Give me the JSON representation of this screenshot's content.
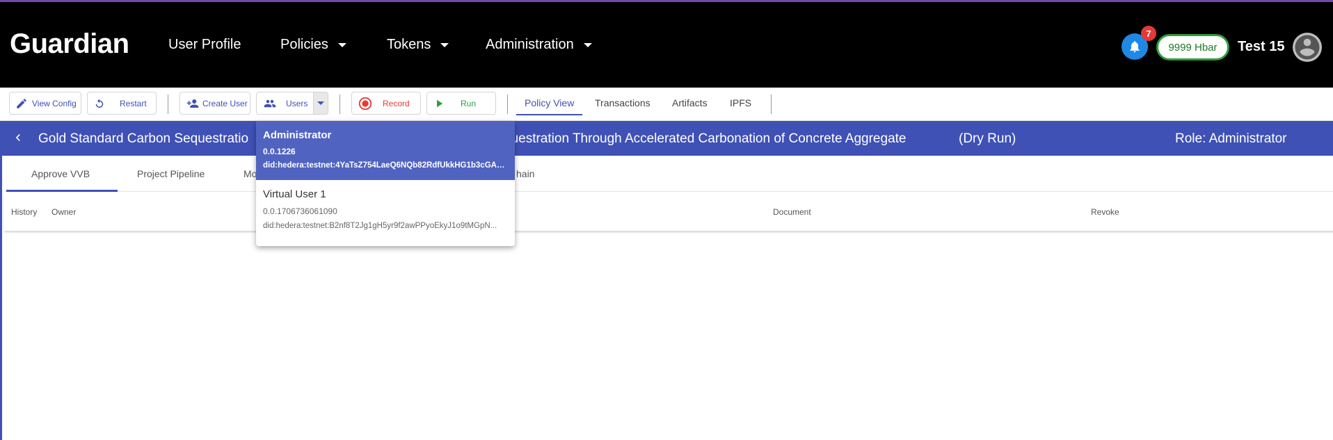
{
  "header": {
    "brand": "Guardian",
    "nav": [
      "User Profile",
      "Policies",
      "Tokens",
      "Administration"
    ],
    "notification_count": "7",
    "balance": "9999 Hbar",
    "username": "Test 15",
    "accent_color": "#3f51b5"
  },
  "toolbar": {
    "view_config": "View Config",
    "restart": "Restart",
    "create_user": "Create User",
    "users": "Users",
    "record": "Record",
    "run": "Run",
    "tabs": [
      "Policy View",
      "Transactions",
      "Artifacts",
      "IPFS"
    ],
    "active_tab": "Policy View"
  },
  "policy": {
    "title_left": "Gold Standard Carbon Sequestratio",
    "title_right": "questration Through Accelerated Carbonation of Concrete Aggregate",
    "mode": "(Dry Run)",
    "role": "Role: Administrator"
  },
  "step_tabs": [
    "Approve VVB",
    "Project Pipeline",
    "Mo",
    "hain"
  ],
  "table": {
    "columns": [
      "History",
      "Owner",
      "Document",
      "Revoke"
    ]
  },
  "users_dropdown": {
    "items": [
      {
        "name": "Administrator",
        "account": "0.0.1226",
        "did": "did:hedera:testnet:4YaTsZ754LaeQ6NQb82RdfUkkHG1b3cGAC...",
        "selected": true
      },
      {
        "name": "Virtual User 1",
        "account": "0.0.1706736061090",
        "did": "did:hedera:testnet:B2nf8T2Jg1gH5yr9f2awPPyoEkyJ1o9tMGpN...",
        "selected": false
      }
    ]
  }
}
